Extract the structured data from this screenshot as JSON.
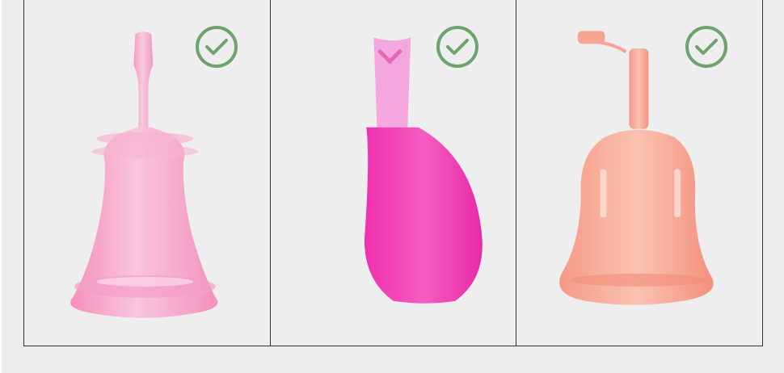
{
  "page": {
    "background": "#ececec",
    "panel_background": "#eeeeee",
    "border_color": "#333333"
  },
  "products": [
    {
      "name": "pink-bell-cup",
      "check_icon": "check-circle-icon",
      "color": "#f5a3c7"
    },
    {
      "name": "magenta-teardrop-cup",
      "check_icon": "check-circle-icon",
      "color": "#f23bb2"
    },
    {
      "name": "coral-bell-cup-with-cap",
      "check_icon": "check-circle-icon",
      "color": "#f6a592"
    }
  ],
  "icon_color": "#6ea36d"
}
